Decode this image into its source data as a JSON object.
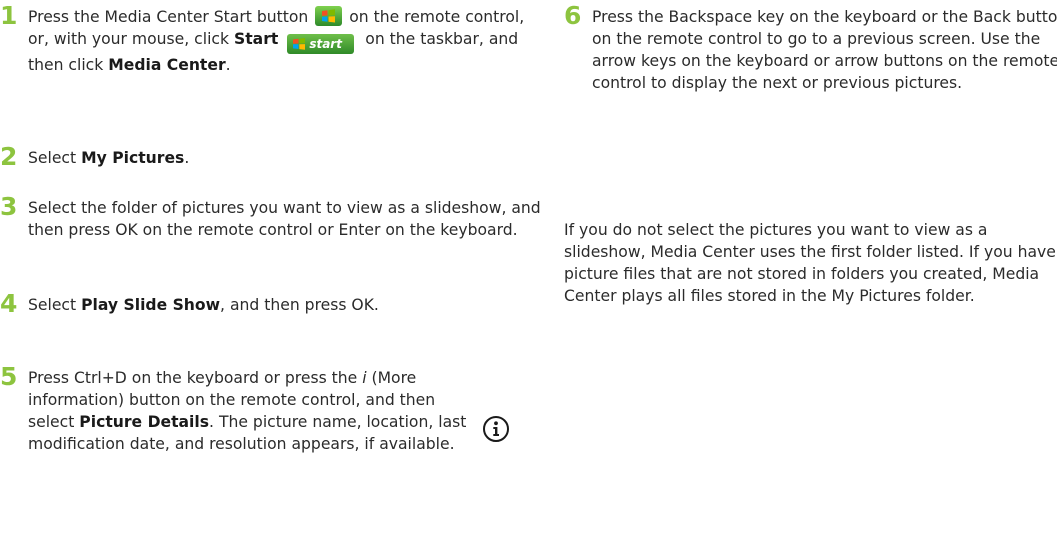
{
  "colors": {
    "step_number": "#8dc43f",
    "text": "#2b2b2b",
    "start_button": "#3a962e"
  },
  "icons": {
    "media_center_start": "windows-flag-icon",
    "taskbar_start": "start-button-icon",
    "more_information": "info-icon"
  },
  "steps": [
    {
      "number": "1",
      "t1": "Press the Media Center Start button",
      "t2": "on the remote control, or, with your mouse, click",
      "b1": "Start",
      "start_label": "start",
      "t3": "on the taskbar, and then click",
      "b2": "Media Center",
      "t4": "."
    },
    {
      "number": "2",
      "t1": "Select ",
      "b1": "My Pictures",
      "t2": "."
    },
    {
      "number": "3",
      "t1": "Select the folder of pictures you want to view as a slideshow, and then press OK on the remote control or Enter on the keyboard."
    },
    {
      "number": "4",
      "t1": "Select ",
      "b1": "Play Slide Show",
      "t2": ", and then press OK."
    },
    {
      "number": "5",
      "t1": "Press Ctrl+D on the keyboard or press the ",
      "i1": "i",
      "t2": " (More information) button on the remote control, and then select ",
      "b1": "Picture Details",
      "t3": ". The picture name, location, last modification date, and resolution appears, if available."
    },
    {
      "number": "6",
      "t1": "Press the Backspace key on the keyboard or the Back button on the remote control to go to a previous screen. Use the arrow keys on the keyboard or arrow buttons on the remote control to display the next or previous pictures."
    }
  ],
  "note": "If you do not select the pictures you want to view as a slideshow, Media Center uses the first folder listed. If you have picture files that are not stored in folders you created, Media Center plays all files stored in the My Pictures folder."
}
